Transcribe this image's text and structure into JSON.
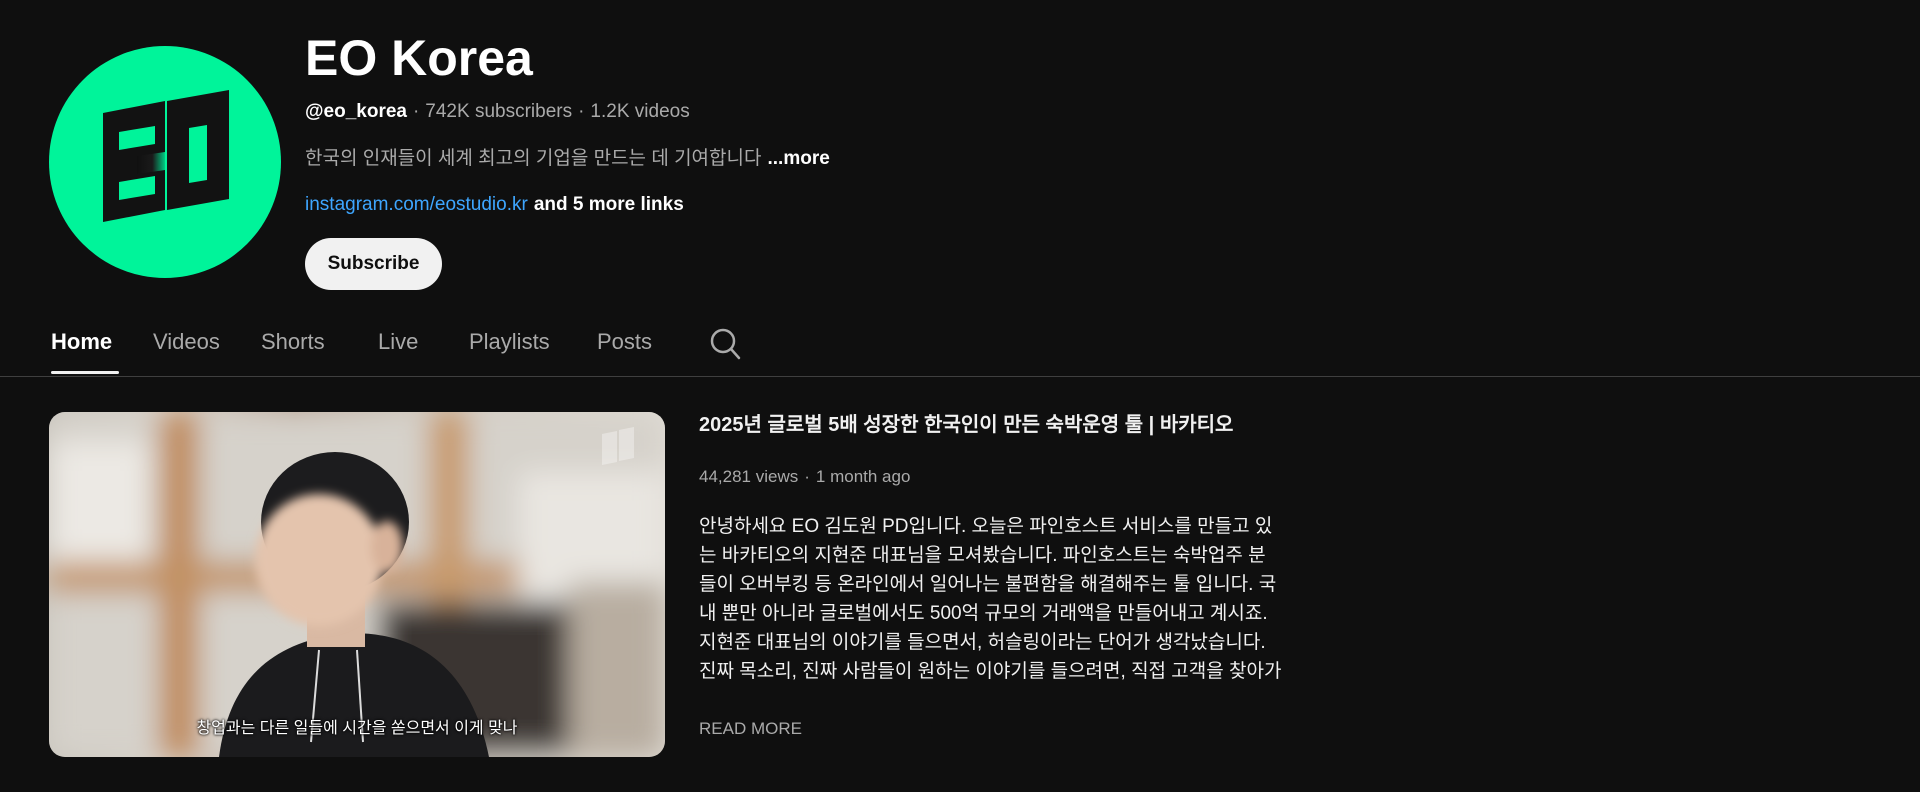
{
  "channel": {
    "avatar_icon": "eo-logo-icon",
    "brand_color": "#00f49a",
    "name": "EO Korea",
    "handle": "@eo_korea",
    "subscribers": "742K subscribers",
    "videos": "1.2K videos",
    "description": "한국의 인재들이 세계 최고의 기업을 만드는 데 기여합니다",
    "description_more": "...more",
    "link": "instagram.com/eostudio.kr",
    "more_links": "and 5 more links",
    "subscribe_label": "Subscribe"
  },
  "tabs": {
    "home": "Home",
    "videos": "Videos",
    "shorts": "Shorts",
    "live": "Live",
    "playlists": "Playlists",
    "posts": "Posts",
    "active": "Home",
    "search_icon": "search-icon"
  },
  "featured_video": {
    "thumbnail_caption": "창업과는 다른 일들에 시간을 쏟으면서 이게 맞나",
    "title": "2025년 글로벌 5배 성장한 한국인이 만든 숙박운영 툴 | 바카티오",
    "views": "44,281 views",
    "age": "1 month ago",
    "description": "안녕하세요 EO 김도원 PD입니다. 오늘은 파인호스트 서비스를 만들고 있는 바카티오의 지현준 대표님을 모셔봤습니다. 파인호스트는 숙박업주 분들이 오버부킹 등 온라인에서 일어나는 불편함을 해결해주는 툴 입니다. 국내 뿐만 아니라 글로벌에서도 500억 규모의 거래액을 만들어내고 계시죠. 지현준 대표님의 이야기를 들으면서, 허슬링이라는 단어가 생각났습니다. 진짜 목소리, 진짜 사람들이 원하는 이야기를 들으려면, 직접 고객을 찾아가서 부딪히고 해결해야하는 것이죠. 다만 진짜 목소리를 듣기까지는 '이...",
    "read_more": "READ MORE"
  }
}
